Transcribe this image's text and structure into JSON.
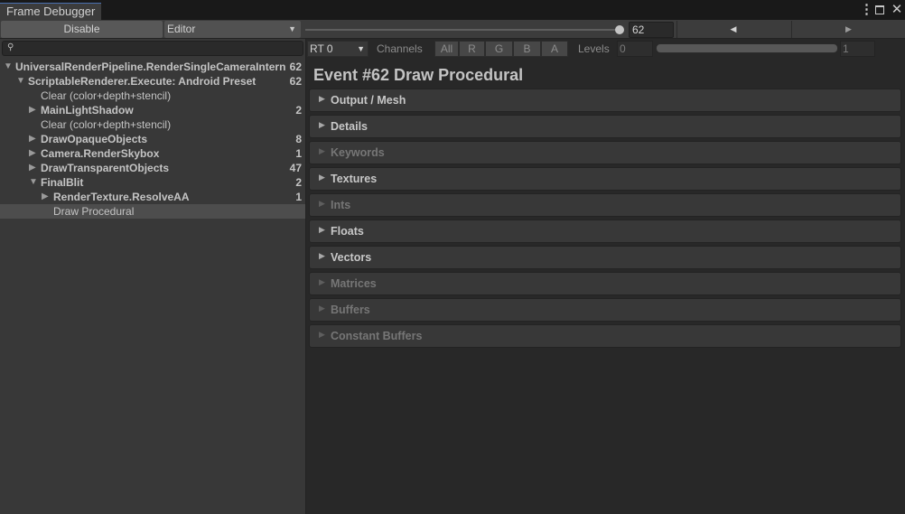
{
  "window": {
    "tab_title": "Frame Debugger",
    "menu_icon": "more-vertical-icon",
    "maximize_icon": "maximize-icon",
    "close_icon": "close-icon"
  },
  "toolbar": {
    "disable_label": "Disable",
    "target_selected": "Editor",
    "event_slider_value": 62,
    "event_number": "62",
    "prev_icon": "triangle-left-icon",
    "next_icon": "triangle-right-icon"
  },
  "search": {
    "value": "",
    "icon": "search-icon"
  },
  "tree": [
    {
      "label": "UniversalRenderPipeline.RenderSingleCameraInternal",
      "count": "62",
      "depth": 0,
      "expanded": true,
      "has_children": true,
      "bold": true,
      "selected": false
    },
    {
      "label": "ScriptableRenderer.Execute: Android Preset",
      "count": "62",
      "depth": 1,
      "expanded": true,
      "has_children": true,
      "bold": true,
      "selected": false
    },
    {
      "label": "Clear (color+depth+stencil)",
      "count": "",
      "depth": 2,
      "expanded": false,
      "has_children": false,
      "bold": false,
      "selected": false
    },
    {
      "label": "MainLightShadow",
      "count": "2",
      "depth": 2,
      "expanded": false,
      "has_children": true,
      "bold": true,
      "selected": false
    },
    {
      "label": "Clear (color+depth+stencil)",
      "count": "",
      "depth": 2,
      "expanded": false,
      "has_children": false,
      "bold": false,
      "selected": false
    },
    {
      "label": "DrawOpaqueObjects",
      "count": "8",
      "depth": 2,
      "expanded": false,
      "has_children": true,
      "bold": true,
      "selected": false
    },
    {
      "label": "Camera.RenderSkybox",
      "count": "1",
      "depth": 2,
      "expanded": false,
      "has_children": true,
      "bold": true,
      "selected": false
    },
    {
      "label": "DrawTransparentObjects",
      "count": "47",
      "depth": 2,
      "expanded": false,
      "has_children": true,
      "bold": true,
      "selected": false
    },
    {
      "label": "FinalBlit",
      "count": "2",
      "depth": 2,
      "expanded": true,
      "has_children": true,
      "bold": true,
      "selected": false
    },
    {
      "label": "RenderTexture.ResolveAA",
      "count": "1",
      "depth": 3,
      "expanded": false,
      "has_children": true,
      "bold": true,
      "selected": false
    },
    {
      "label": "Draw Procedural",
      "count": "",
      "depth": 3,
      "expanded": false,
      "has_children": false,
      "bold": false,
      "selected": true
    }
  ],
  "render_target": {
    "selected": "RT 0"
  },
  "channels": {
    "label": "Channels",
    "buttons": [
      "All",
      "R",
      "G",
      "B",
      "A"
    ]
  },
  "levels": {
    "label": "Levels",
    "min": "0",
    "max": "1"
  },
  "event": {
    "title": "Event #62 Draw Procedural",
    "sections": [
      {
        "label": "Output / Mesh",
        "enabled": true
      },
      {
        "label": "Details",
        "enabled": true
      },
      {
        "label": "Keywords",
        "enabled": false
      },
      {
        "label": "Textures",
        "enabled": true
      },
      {
        "label": "Ints",
        "enabled": false
      },
      {
        "label": "Floats",
        "enabled": true
      },
      {
        "label": "Vectors",
        "enabled": true
      },
      {
        "label": "Matrices",
        "enabled": false
      },
      {
        "label": "Buffers",
        "enabled": false
      },
      {
        "label": "Constant Buffers",
        "enabled": false
      }
    ]
  },
  "colors": {
    "background": "#282828",
    "panel": "#383838",
    "toolbar": "#3c3c3c",
    "selection": "#4d4d4d",
    "tab_accent": "#4a6fb0"
  }
}
